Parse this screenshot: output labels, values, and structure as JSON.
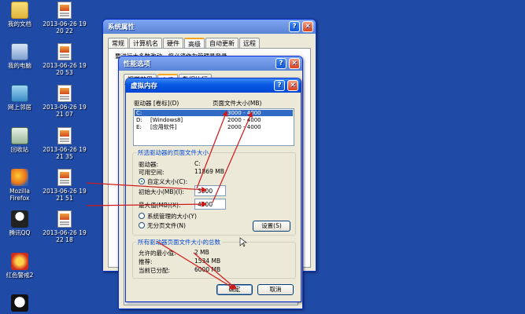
{
  "desktop": {
    "left_icons": [
      {
        "name": "my-documents",
        "label": "我的文档",
        "icon": "folder-icon"
      },
      {
        "name": "my-computer",
        "label": "我的电脑",
        "icon": "computer-icon"
      },
      {
        "name": "network",
        "label": "网上邻居",
        "icon": "network-icon"
      },
      {
        "name": "recycle-bin",
        "label": "回收站",
        "icon": "recycle-bin-icon"
      },
      {
        "name": "firefox",
        "label": "Mozilla Firefox",
        "icon": "firefox-icon"
      },
      {
        "name": "qq",
        "label": "腾讯QQ",
        "icon": "qq-icon"
      },
      {
        "name": "red-alert",
        "label": "红色警戒2",
        "icon": "red-alert-icon"
      },
      {
        "name": "panda",
        "label": "",
        "icon": "panda-icon"
      }
    ],
    "image_icons": [
      {
        "line1": "2013-06-26 19",
        "line2": "20 22"
      },
      {
        "line1": "2013-06-26 19",
        "line2": "20 53"
      },
      {
        "line1": "2013-06-26 19",
        "line2": "21 07"
      },
      {
        "line1": "2013-06-26 19",
        "line2": "21 35"
      },
      {
        "line1": "2013-06-26 19",
        "line2": "21 51"
      },
      {
        "line1": "2013-06-26 19",
        "line2": "22 18"
      }
    ]
  },
  "sysprops": {
    "title": "系统属性",
    "tabs": [
      "常规",
      "计算机名",
      "硬件",
      "高级",
      "自动更新",
      "远程"
    ],
    "partial_text": "要进行大多数改动，您必须作为管理员登录。"
  },
  "perf": {
    "title": "性能选项",
    "tabs": [
      "视觉效果",
      "高级",
      "数据执行"
    ]
  },
  "vm": {
    "title": "虚拟内存",
    "col_drive": "驱动器 [卷标](D)",
    "col_size": "页面文件大小(MB)",
    "drives": [
      {
        "drive": "C:",
        "label": "",
        "size": "3000 - 4000"
      },
      {
        "drive": "D:",
        "label": "[Windows8]",
        "size": "2000 - 4000"
      },
      {
        "drive": "E:",
        "label": "[应用软件]",
        "size": "2000 - 4000"
      }
    ],
    "selected_group": {
      "title": "所选驱动器的页面文件大小",
      "drive_label": "驱动器:",
      "drive_value": "C:",
      "space_label": "可用空间:",
      "space_value": "11869 MB",
      "custom_label": "自定义大小(C):",
      "initial_label": "初始大小(MB)(I):",
      "initial_value": "3000",
      "max_label": "最大值(MB)(X):",
      "max_value": "4000",
      "system_label": "系统管理的大小(Y)",
      "none_label": "无分页文件(N)",
      "set_button": "设置(S)"
    },
    "total_group": {
      "title": "所有驱动器页面文件大小的总数",
      "min_label": "允许的最小值:",
      "min_value": "2 MB",
      "rec_label": "推荐:",
      "rec_value": "1534 MB",
      "cur_label": "当前已分配:",
      "cur_value": "6000 MB"
    },
    "ok_button": "确定",
    "cancel_button": "取消"
  },
  "colors": {
    "desktop": "#1f4aa6",
    "titlebar": "#0a5ae4",
    "window_bg": "#ece9d8",
    "arrow": "#d01818",
    "group_title": "#0046d5"
  }
}
